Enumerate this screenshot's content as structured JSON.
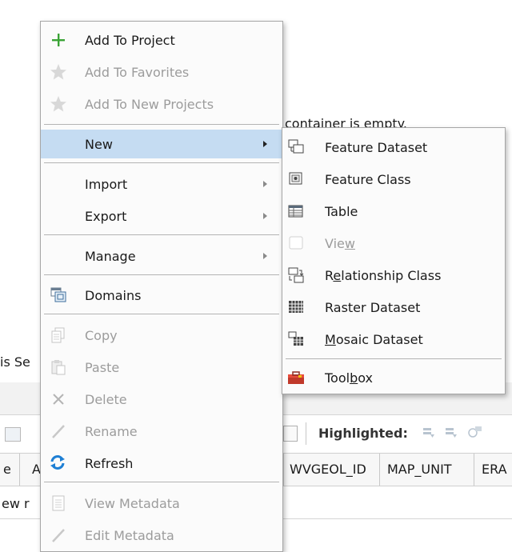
{
  "background": {
    "empty_message": "container is empty.",
    "partial_label_left": "is Se",
    "toolbar_label": "Highlighted:",
    "table_headers": [
      "e",
      "A",
      "WVGEOL_ID",
      "MAP_UNIT",
      "ERA"
    ],
    "partial_row_text": "ew r"
  },
  "context_menu": {
    "add_to_project": "Add To Project",
    "add_to_favorites": "Add To Favorites",
    "add_to_new_projects": "Add To New Projects",
    "new": "New",
    "import": "Import",
    "export": "Export",
    "manage": "Manage",
    "domains": "Domains",
    "copy": "Copy",
    "paste": "Paste",
    "delete": "Delete",
    "rename": "Rename",
    "refresh": "Refresh",
    "view_metadata": "View Metadata",
    "edit_metadata": "Edit Metadata"
  },
  "new_submenu": {
    "feature_dataset": "Feature Dataset",
    "feature_class": "Feature Class",
    "table": "Table",
    "view_pre": "Vie",
    "view_ul": "w",
    "relationship_pre": "R",
    "relationship_ul": "e",
    "relationship_post": "lationship Class",
    "raster_dataset": "Raster Dataset",
    "mosaic_ul": "M",
    "mosaic_post": "osaic Dataset",
    "toolbox_pre": "Tool",
    "toolbox_ul": "b",
    "toolbox_post": "ox"
  },
  "colors": {
    "accent_green": "#3aa335",
    "refresh_blue": "#1e7fd4",
    "hover_blue": "#c5dcf2",
    "disabled_text": "#9c9c9c"
  }
}
